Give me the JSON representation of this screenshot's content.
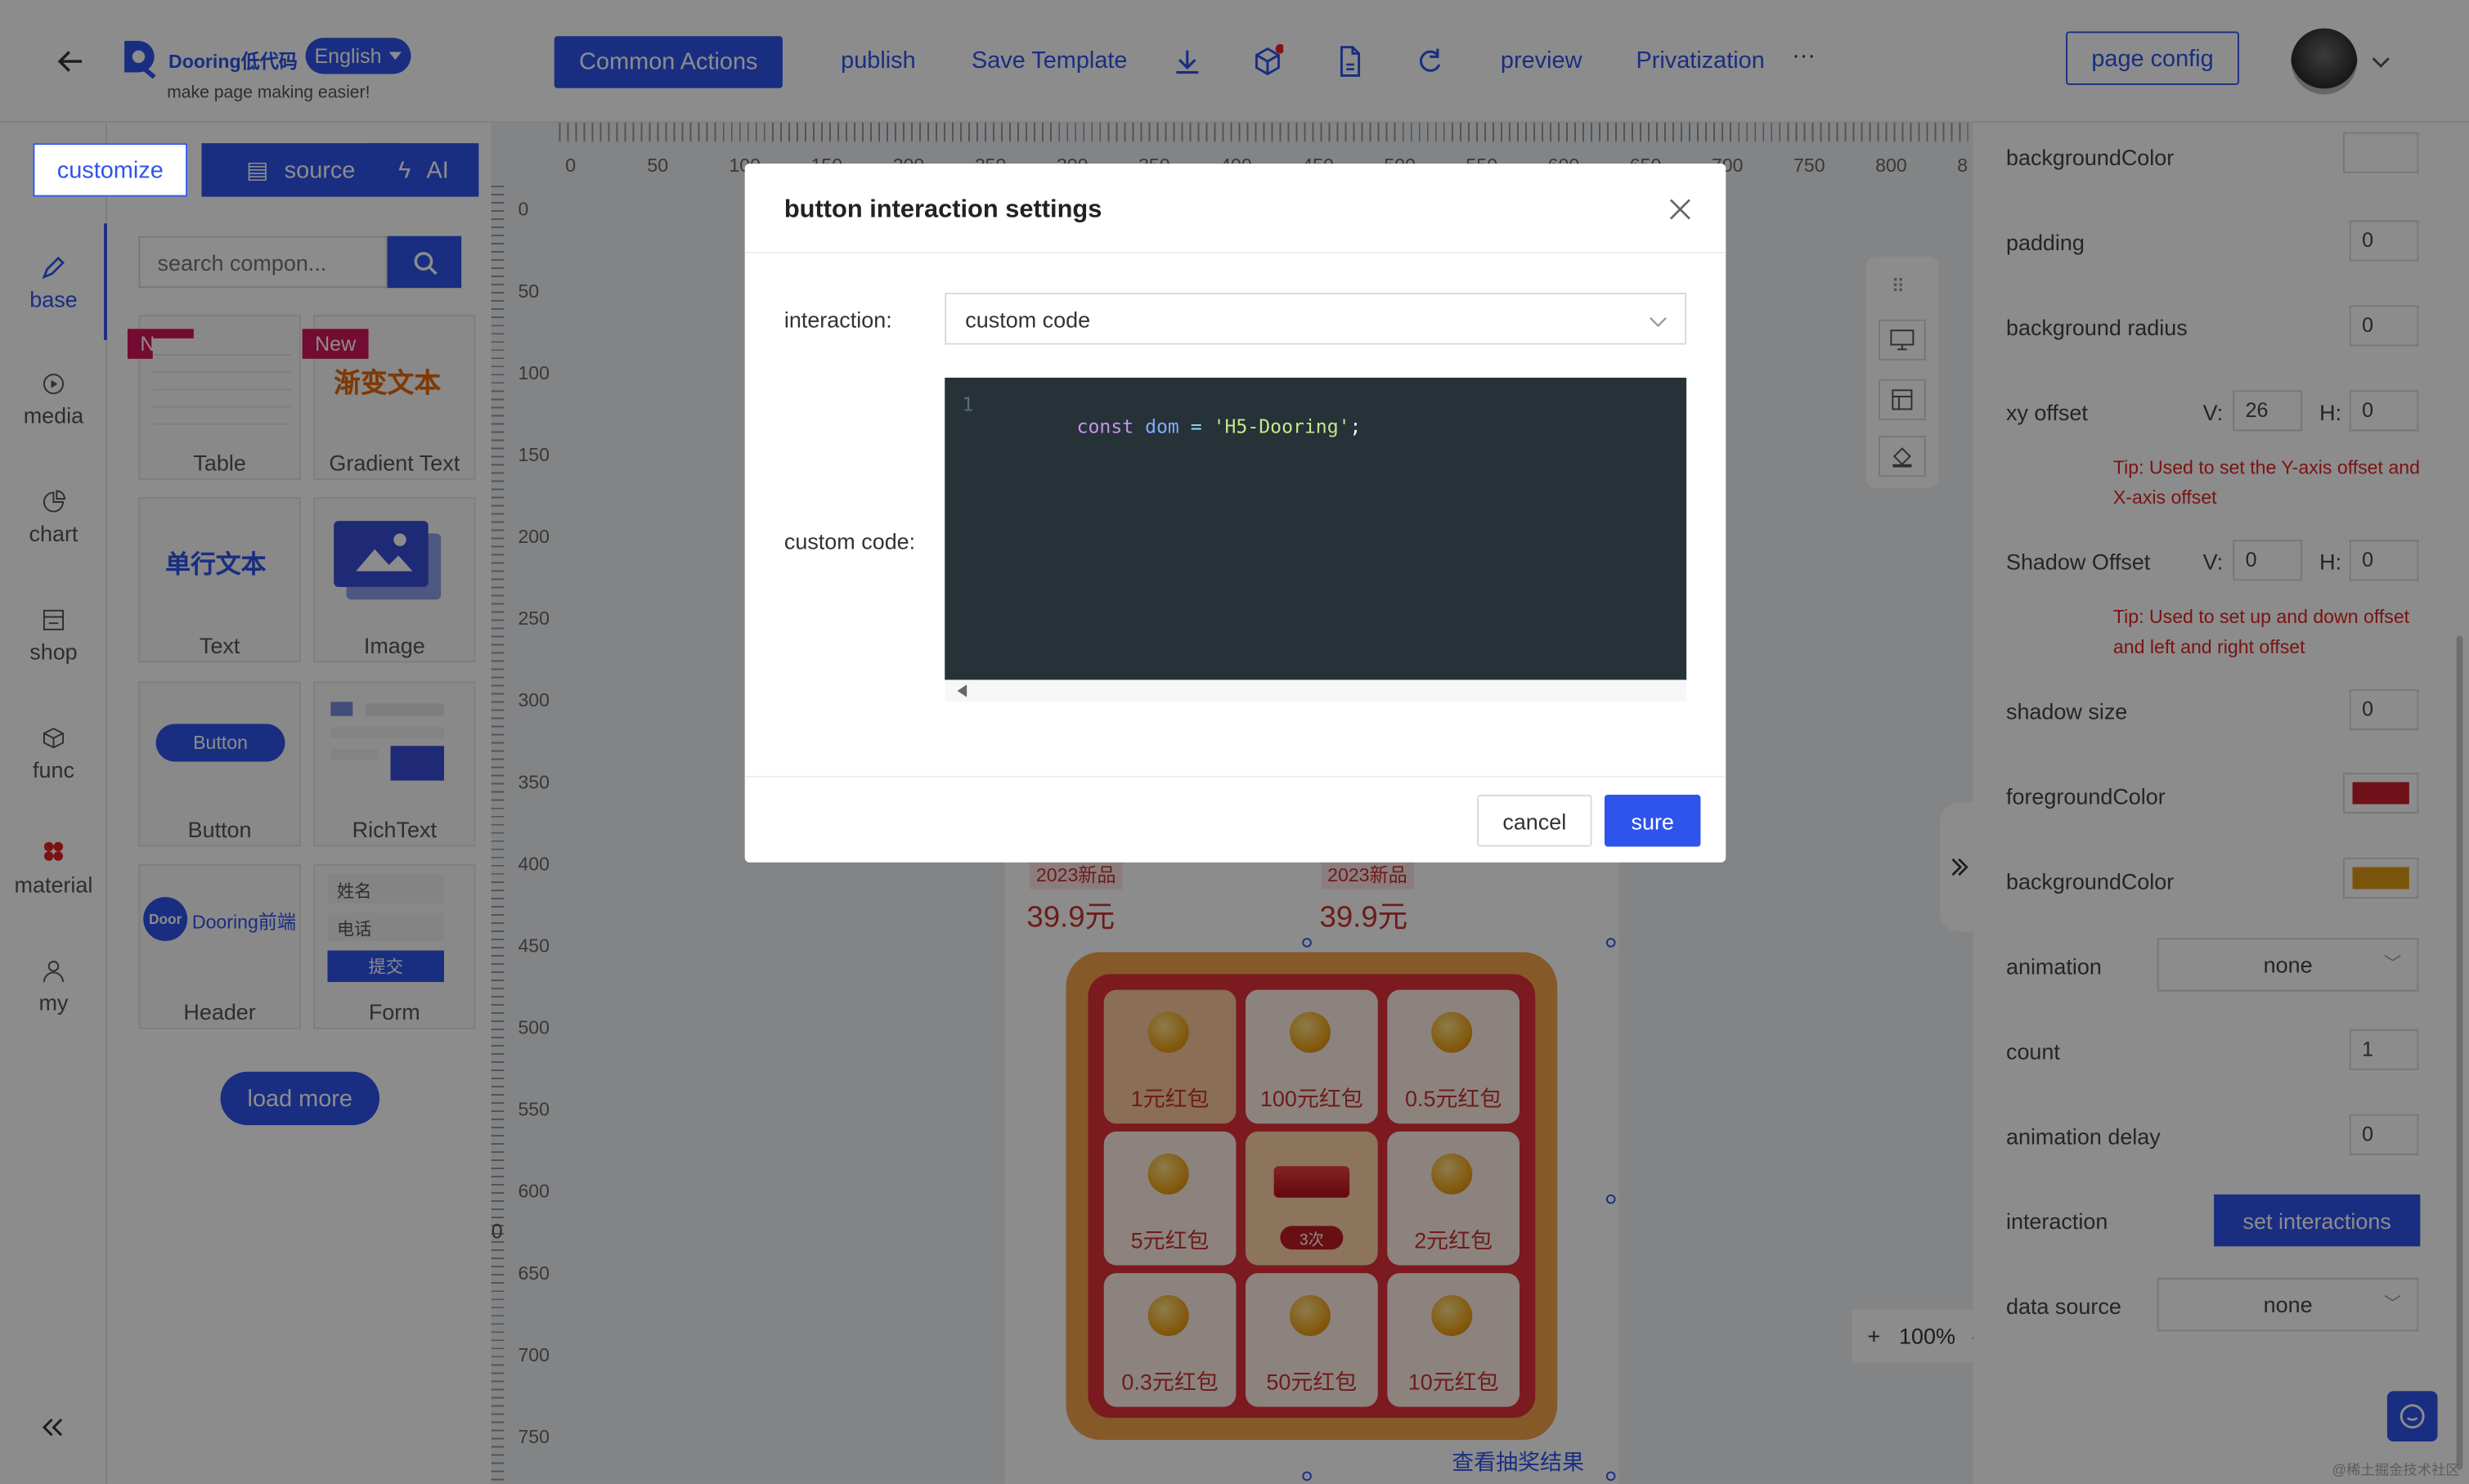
{
  "header": {
    "logo_text": "Dooring低代码",
    "language": "English",
    "slogan": "make page making easier!",
    "common_actions": "Common Actions",
    "publish": "publish",
    "save_template": "Save Template",
    "preview": "preview",
    "privatization": "Privatization",
    "more": "···",
    "page_config": "page config"
  },
  "left_tabs": {
    "customize": "customize",
    "source": "source",
    "ai": "AI"
  },
  "categories": [
    "base",
    "media",
    "chart",
    "shop",
    "func",
    "material",
    "my"
  ],
  "search": {
    "placeholder": "search compon..."
  },
  "components": [
    "Table",
    "Gradient Text",
    "Text",
    "Image",
    "Button",
    "RichText",
    "Header",
    "Form"
  ],
  "component_previews": {
    "new_tag": "New",
    "gradient_text": "渐变文本",
    "single_text": "单行文本",
    "button_text": "Button",
    "header_logo": "Door",
    "header_text": "Dooring前端",
    "form_name": "姓名",
    "form_phone": "电话",
    "form_submit": "提交"
  },
  "load_more": "load more",
  "ruler": {
    "x": [
      "0",
      "50",
      "100",
      "150",
      "200",
      "250",
      "300",
      "350",
      "400",
      "450",
      "500",
      "550",
      "600",
      "650",
      "700",
      "750",
      "800",
      "8"
    ],
    "y": [
      "0",
      "50",
      "100",
      "150",
      "200",
      "250",
      "300",
      "350",
      "400",
      "450",
      "500",
      "550",
      "600",
      "650",
      "700",
      "750"
    ],
    "y_origin": "0"
  },
  "canvas": {
    "product_tag_1": "2023新品",
    "product_tag_2": "2023新品",
    "price_1": "39.9元",
    "price_2": "39.9元",
    "lottery": [
      "1元红包",
      "100元红包",
      "0.5元红包",
      "5元红包",
      "3次",
      "2元红包",
      "0.3元红包",
      "50元红包",
      "10元红包"
    ],
    "result_link": "查看抽奖结果",
    "zoom": "100%",
    "zoom_plus": "+",
    "zoom_minus": "-"
  },
  "right_panel": {
    "background_color": "backgroundColor",
    "padding": "padding",
    "padding_value": "0",
    "background_radius": "background radius",
    "radius_value": "0",
    "xy_offset": "xy offset",
    "v_label": "V:",
    "h_label": "H:",
    "xy_v": "26",
    "xy_h": "0",
    "xy_tip": "Tip: Used to set the Y-axis offset and X-axis offset",
    "shadow_offset": "Shadow Offset",
    "shadow_v": "0",
    "shadow_h": "0",
    "shadow_tip": "Tip: Used to set up and down offset and left and right offset",
    "shadow_size": "shadow size",
    "shadow_size_value": "0",
    "foreground_color": "foregroundColor",
    "foreground_color_value": "#c8202f",
    "background_color_2": "backgroundColor",
    "background_color_2_value": "#e09a16",
    "animation": "animation",
    "animation_value": "none",
    "count": "count",
    "count_value": "1",
    "animation_delay": "animation delay",
    "animation_delay_value": "0",
    "interaction": "interaction",
    "set_interactions": "set interactions",
    "data_source": "data source",
    "data_source_value": "none"
  },
  "modal": {
    "title": "button interaction settings",
    "interaction_label": "interaction:",
    "interaction_value": "custom code",
    "custom_code_label": "custom code:",
    "code_line_no": "1",
    "code_kw": "const",
    "code_var": "dom",
    "code_eq": "=",
    "code_str": "'H5-Dooring'",
    "code_semi": ";",
    "cancel": "cancel",
    "sure": "sure"
  },
  "watermark": "@稀土掘金技术社区",
  "colors": {
    "primary": "#2f54eb",
    "editor_bg": "#263238",
    "danger": "#e02424"
  }
}
